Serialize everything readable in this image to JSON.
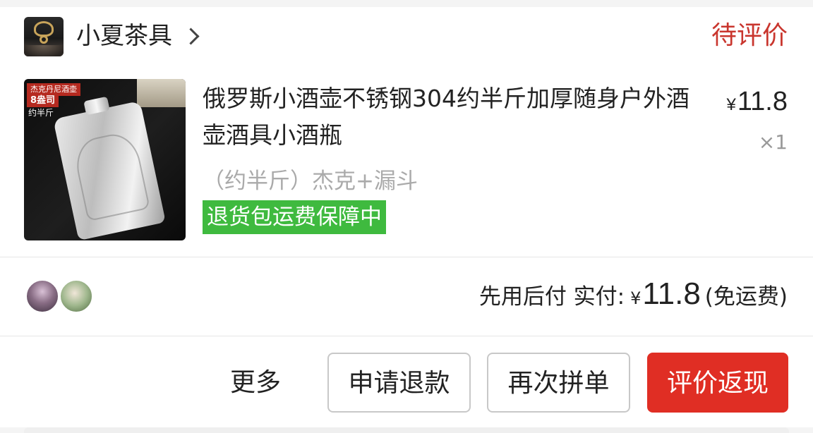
{
  "shop": {
    "name": "小夏茶具",
    "status": "待评价"
  },
  "product": {
    "title": "俄罗斯小酒壶不锈钢304约半斤加厚随身户外酒壶酒具小酒瓶",
    "currency": "¥",
    "price": "11.8",
    "quantity": "×1",
    "spec": "（约半斤）杰克+漏斗",
    "badge": "退货包运费保障中",
    "thumb_tags": [
      "杰克丹尼酒壶",
      "8盎司",
      "约半斤"
    ]
  },
  "payment": {
    "label": "先用后付 实付:",
    "currency": "¥",
    "amount": "11.8",
    "shipping": "(免运费)"
  },
  "actions": {
    "more": "更多",
    "refund": "申请退款",
    "reorder": "再次拼单",
    "review": "评价返现"
  },
  "colors": {
    "status_red": "#c9362e",
    "primary_button": "#e02e24",
    "badge_green": "#3fba3f"
  }
}
